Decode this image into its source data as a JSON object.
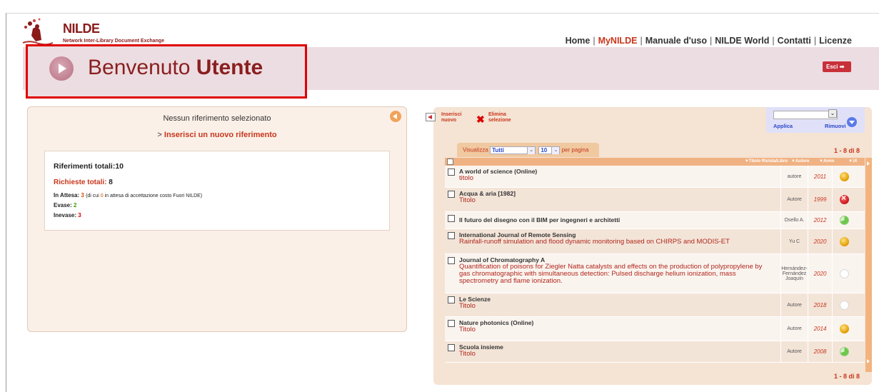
{
  "header": {
    "logo_title": "NILDE",
    "logo_subtitle": "Network Inter-Library Document Exchange",
    "nav": [
      {
        "label": "Home",
        "active": false
      },
      {
        "label": "MyNILDE",
        "active": true
      },
      {
        "label": "Manuale d'uso",
        "active": false
      },
      {
        "label": "NILDE World",
        "active": false
      },
      {
        "label": "Contatti",
        "active": false
      },
      {
        "label": "Licenze",
        "active": false
      }
    ],
    "separator": "|",
    "welcome_prefix": "Benvenuto",
    "welcome_user": "Utente",
    "logout_label": "Esci"
  },
  "left_panel": {
    "no_selection": "Nessun riferimento selezionato",
    "new_ref_prefix": ">",
    "new_ref_link": "Inserisci un nuovo riferimento",
    "total_refs": "Riferimenti totali:10",
    "requests_label": "Richieste totali:",
    "requests_value": "8",
    "pending_label": "In Attesa:",
    "pending_value": "3",
    "pending_note_pre": "(di cui",
    "pending_note_value": "0",
    "pending_note_post": "in attesa di accettazione costo Fuori NILDE)",
    "fulfilled_label": "Evase:",
    "fulfilled_value": "2",
    "unfulfilled_label": "Inevase:",
    "unfulfilled_value": "3"
  },
  "toolbar": {
    "insert_line1": "Inserisci",
    "insert_line2": "nuovo",
    "delete_line1": "Elimina",
    "delete_line2": "selezione",
    "apply": "Applica",
    "remove": "Rimuovi"
  },
  "list": {
    "show_label": "Visualizza",
    "show_value": "Tutti",
    "per_page_value": "10",
    "per_page_label": "per pagina",
    "count": "1 - 8 di 8",
    "columns": {
      "title": "Titolo Rivista/Libro",
      "author": "Autore",
      "year": "Anno",
      "status": "Ut"
    },
    "rows": [
      {
        "t1": "A world of science (Online)",
        "t2": "titolo",
        "author": "autore",
        "year": "2011",
        "status": "inattesa"
      },
      {
        "t1": "Acqua & aria [1982]",
        "t2": "Titolo",
        "author": "Autore",
        "year": "1999",
        "status": "inevasa"
      },
      {
        "t1": "Il futuro del disegno con il BIM per ingegneri e architetti",
        "t2": "",
        "author": "Osello A.",
        "year": "2012",
        "status": "evasa"
      },
      {
        "t1": "International Journal of Remote Sensing",
        "t2": "Rainfall-runoff simulation and flood dynamic monitoring based on CHIRPS and MODIS-ET",
        "author": "Yu C",
        "year": "2020",
        "status": "inattesa"
      },
      {
        "t1": "Journal of Chromatography A",
        "t2": "Quantification of poisons for Ziegler Natta catalysts and effects on the production of polypropylene by gas chromatographic with simultaneous detection: Pulsed discharge helium ionization, mass spectrometry and flame ionization.",
        "author": "Hernández-Fernández Joaquín",
        "year": "2020",
        "status": "empty"
      },
      {
        "t1": "Le Scienze",
        "t2": "Titolo",
        "author": "Autore",
        "year": "2018",
        "status": "empty"
      },
      {
        "t1": "Nature photonics (Online)",
        "t2": "Titolo",
        "author": "Autore",
        "year": "2014",
        "status": "inattesa"
      },
      {
        "t1": "Scuola insieme",
        "t2": "Titolo",
        "author": "Autore",
        "year": "2008",
        "status": "evasa"
      }
    ]
  }
}
